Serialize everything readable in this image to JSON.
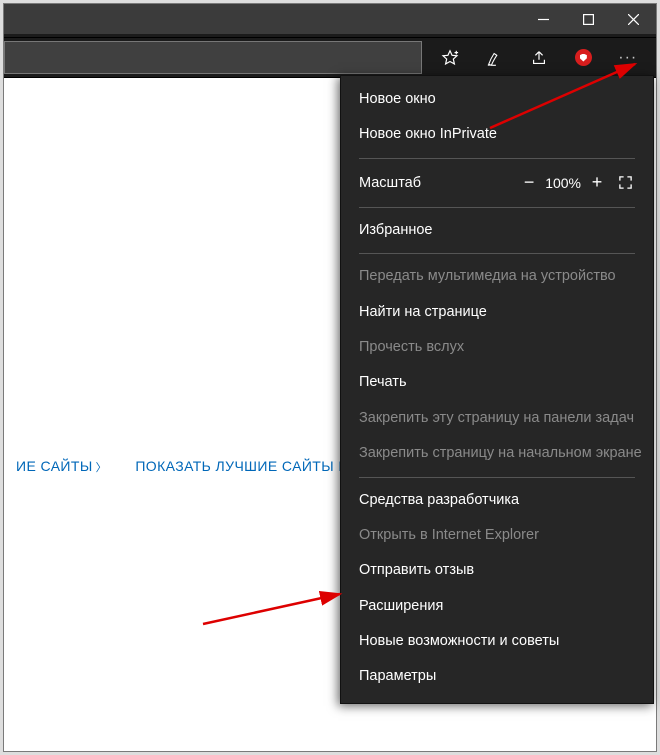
{
  "zoom": {
    "label": "Масштаб",
    "value": "100%"
  },
  "menu": {
    "new_window": "Новое окно",
    "new_inprivate": "Новое окно InPrivate",
    "favorites": "Избранное",
    "cast": "Передать мультимедиа на устройство",
    "find": "Найти на странице",
    "read_aloud": "Прочесть вслух",
    "print": "Печать",
    "pin_taskbar": "Закрепить эту страницу на панели задач",
    "pin_start": "Закрепить страницу на начальном экране",
    "devtools": "Средства разработчика",
    "open_ie": "Открыть в Internet Explorer",
    "feedback": "Отправить отзыв",
    "extensions": "Расширения",
    "tips": "Новые возможности и советы",
    "settings": "Параметры"
  },
  "quicklinks": {
    "a": "ИЕ САЙТЫ",
    "b": "ПОКАЗАТЬ ЛУЧШИЕ САЙТЫ И МОЮ"
  }
}
